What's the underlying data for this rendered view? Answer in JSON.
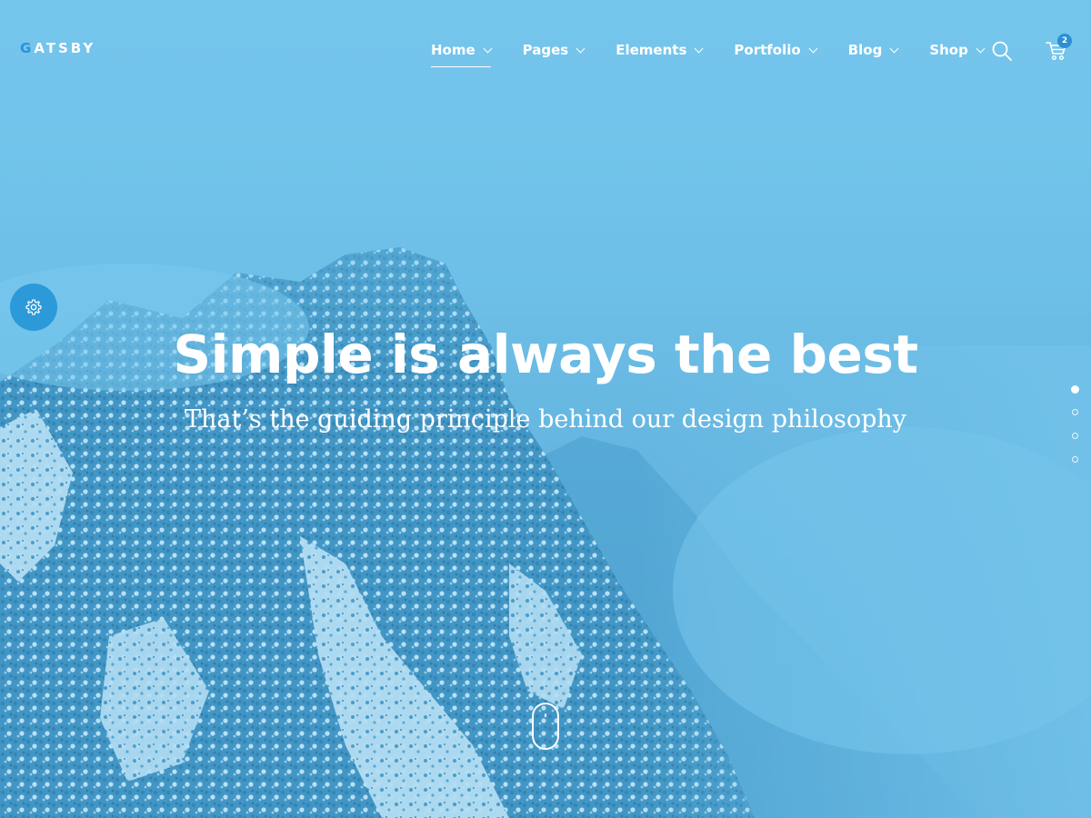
{
  "brand": {
    "logo_first_letter": "G",
    "logo_rest": "ATSBY"
  },
  "nav": {
    "items": [
      {
        "label": "Home",
        "active": true
      },
      {
        "label": "Pages",
        "active": false
      },
      {
        "label": "Elements",
        "active": false
      },
      {
        "label": "Portfolio",
        "active": false
      },
      {
        "label": "Blog",
        "active": false
      },
      {
        "label": "Shop",
        "active": false
      }
    ]
  },
  "header": {
    "search_icon": "search-icon",
    "cart_icon": "cart-icon",
    "cart_count": "2"
  },
  "settings": {
    "icon": "gear-icon"
  },
  "hero": {
    "title": "Simple is always the best",
    "subtitle": "That’s the guiding principle behind our design philosophy"
  },
  "slider": {
    "slide_count": 4,
    "active_index": 0
  },
  "scroll": {
    "icon": "mouse-scroll-icon"
  },
  "colors": {
    "overlay": "#76c3e8",
    "accent": "#2b93d6",
    "badge": "#2b8fd3",
    "text": "#ffffff"
  }
}
